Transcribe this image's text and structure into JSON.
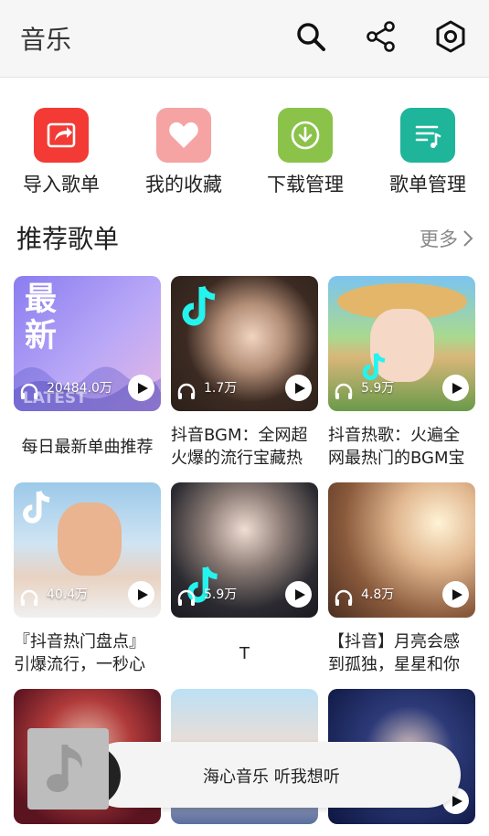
{
  "header": {
    "title": "音乐"
  },
  "quick_actions": [
    {
      "label": "导入歌单",
      "color": "#f43a34",
      "icon": "import-icon"
    },
    {
      "label": "我的收藏",
      "color": "#f5a3a3",
      "icon": "heart-icon"
    },
    {
      "label": "下载管理",
      "color": "#8bc34a",
      "icon": "download-icon"
    },
    {
      "label": "歌单管理",
      "color": "#1fb59b",
      "icon": "playlist-icon"
    }
  ],
  "section": {
    "title": "推荐歌单",
    "more_label": "更多"
  },
  "cover_texts": {
    "latest_big": "最\n新",
    "latest_small": "LATEST"
  },
  "playlists": [
    {
      "count": "20484.0万",
      "caption": "每日最新单曲推荐"
    },
    {
      "count": "1.7万",
      "caption": "抖音BGM：全网超火爆的流行宝藏热"
    },
    {
      "count": "5.9万",
      "caption": "抖音热歌：火遍全网最热门的BGM宝"
    },
    {
      "count": "40.4万",
      "caption": "『抖音热门盘点』引爆流行，一秒心"
    },
    {
      "count": "5.9万",
      "caption": "T"
    },
    {
      "count": "4.8万",
      "caption": "【抖音】月亮会感到孤独，星星和你"
    },
    {
      "count": "",
      "caption": ""
    },
    {
      "count": "",
      "caption": ""
    },
    {
      "count": "",
      "caption": ""
    }
  ],
  "player": {
    "text": "海心音乐 听我想听"
  }
}
